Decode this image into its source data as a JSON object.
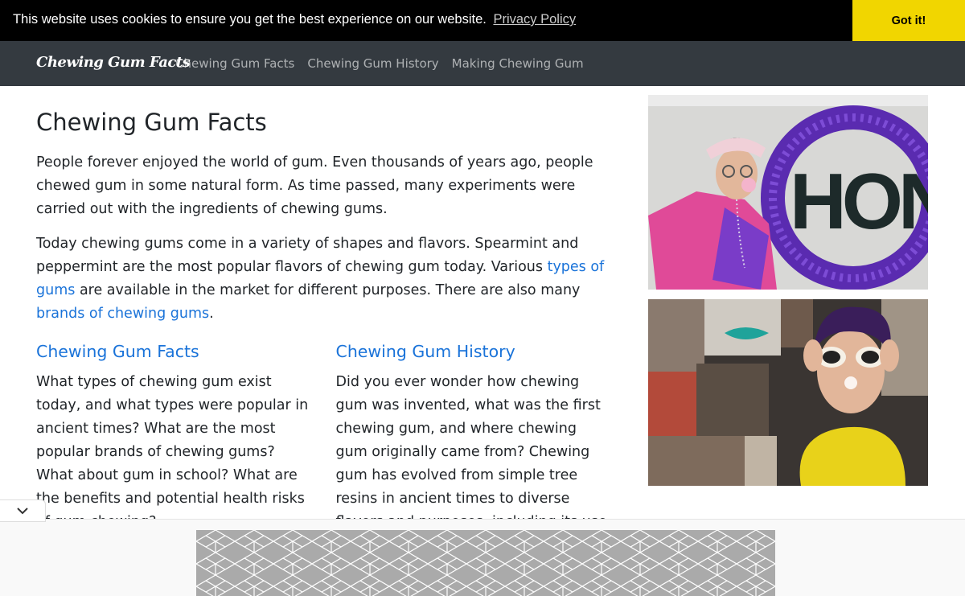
{
  "cookie": {
    "message": "This website uses cookies to ensure you get the best experience on our website.",
    "policy_link": "Privacy Policy",
    "accept_label": "Got it!"
  },
  "nav": {
    "brand": "Chewing Gum Facts",
    "links": [
      "Chewing Gum Facts",
      "Chewing Gum History",
      "Making Chewing Gum"
    ]
  },
  "main": {
    "title": "Chewing Gum Facts",
    "p1": "People forever enjoyed the world of gum. Even thousands of years ago, people chewed gum in some natural form. As time passed, many experiments were carried out with the ingredients of chewing gums.",
    "p2_a": "Today chewing gums come in a variety of shapes and flavors. Spearmint and peppermint are the most popular flavors of chewing gum today. Various ",
    "p2_link1": "types of gums",
    "p2_b": " are available in the market for different purposes. There are also many ",
    "p2_link2": "brands of chewing gums",
    "p2_c": ".",
    "sections": [
      {
        "heading": "Chewing Gum Facts",
        "text": "What types of chewing gum exist today, and what types were popular in ancient times? What are the most popular brands of chewing gums? What about gum in school? What are the benefits and potential health risks of gum chewing?"
      },
      {
        "heading": "Chewing Gum History",
        "text": "Did you ever wonder how chewing gum was invented, what was the first chewing gum, and where chewing gum originally came from? Chewing gum has evolved from simple tree resins in ancient times to diverse flavors and purposes, including its use in military rations."
      }
    ]
  },
  "images": {
    "sign_text": "HON"
  },
  "colors": {
    "cookie_bar": "#000000",
    "cookie_button": "#f1d600",
    "navbar": "#343a40",
    "link": "#1a73d9"
  },
  "icons": {
    "collapse": "chevron-down-icon"
  }
}
